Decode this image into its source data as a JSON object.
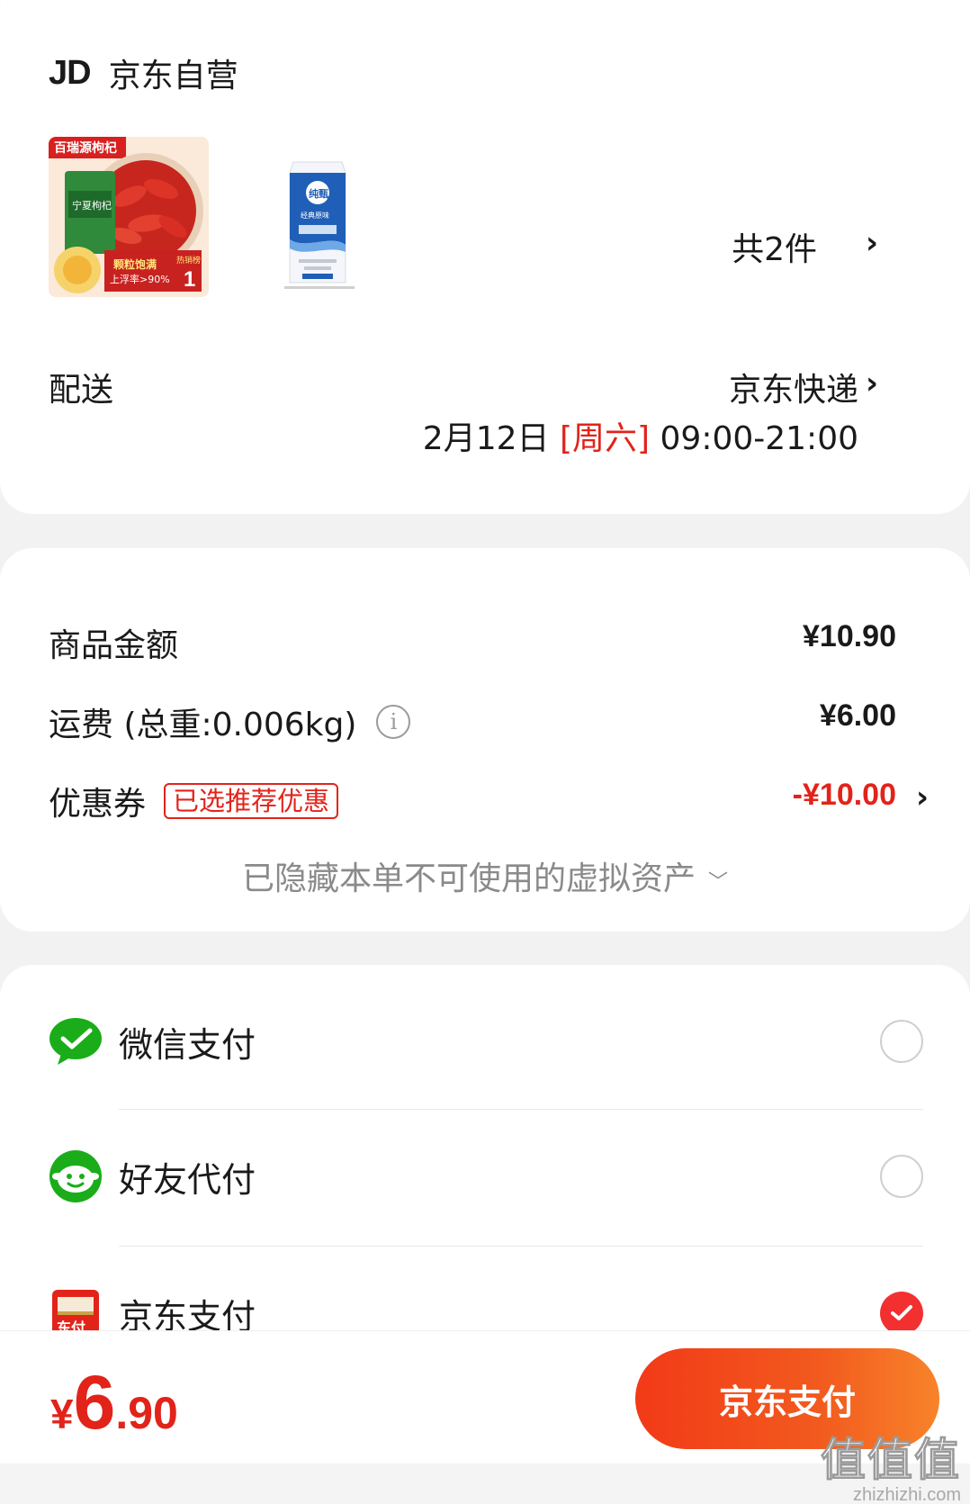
{
  "store": {
    "logo_text": "JD",
    "name": "京东自营"
  },
  "products": {
    "count_label": "共2件",
    "items": [
      {
        "name": "wolfberry-product",
        "badge": "百瑞源枸杞",
        "pack_text": "宁夏枸杞",
        "promo_line1": "颗粒饱满",
        "promo_line2": "上浮率>90%",
        "rank_text": "热销榜",
        "rank_num": "1"
      },
      {
        "name": "milk-carton-product",
        "brand": "纯甄",
        "flavor": "经典原味"
      }
    ]
  },
  "delivery": {
    "label": "配送",
    "method": "京东快递",
    "date": "2月12日",
    "weekday": "[周六]",
    "time_range": "09:00-21:00"
  },
  "amounts": {
    "goods_label": "商品金额",
    "goods_value": "¥10.90",
    "shipping_label": "运费 (总重:0.006kg)",
    "shipping_value": "¥6.00",
    "info_glyph": "i",
    "coupon_label": "优惠券",
    "coupon_tag": "已选推荐优惠",
    "coupon_value": "-¥10.00",
    "hidden_assets": "已隐藏本单不可使用的虚拟资产"
  },
  "payment": {
    "options": [
      {
        "label": "微信支付",
        "selected": false
      },
      {
        "label": "好友代付",
        "selected": false
      },
      {
        "label": "京东支付",
        "selected": true,
        "icon_text": "东付"
      }
    ]
  },
  "footer": {
    "total_symbol": "¥",
    "total_int": "6",
    "total_dec": ".90",
    "pay_button": "京东支付"
  },
  "watermark": {
    "big": "值值值",
    "small": "zhizhizhi.com"
  },
  "colors": {
    "accent_red": "#e2231a",
    "wechat_green": "#1aad19",
    "button_gradient_start": "#f23a18",
    "button_gradient_end": "#f8832a"
  }
}
